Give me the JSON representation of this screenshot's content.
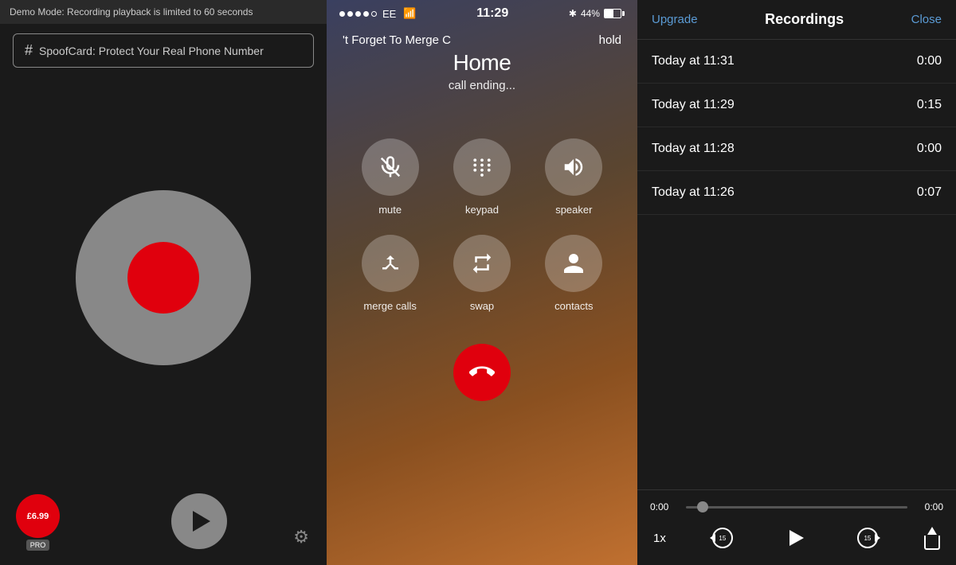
{
  "left": {
    "demo_banner": "Demo Mode: Recording playback is limited to 60 seconds",
    "spoofcard_label": "SpoofCard: Protect Your Real Phone Number",
    "hash_symbol": "#",
    "price": "£6.99",
    "pro_label": "PRO",
    "settings_symbol": "⚙"
  },
  "phone": {
    "carrier": "EE",
    "signal_dots": [
      "filled",
      "filled",
      "filled",
      "filled",
      "empty"
    ],
    "time": "11:29",
    "bluetooth": "Bluetooth",
    "battery_percent": "44%",
    "call_top_left": "'t Forget To Merge C",
    "call_top_right": "hold",
    "call_name": "Home",
    "call_status": "call ending...",
    "controls": [
      {
        "id": "mute",
        "label": "mute"
      },
      {
        "id": "keypad",
        "label": "keypad"
      },
      {
        "id": "speaker",
        "label": "speaker"
      },
      {
        "id": "merge-calls",
        "label": "merge calls"
      },
      {
        "id": "swap",
        "label": "swap"
      },
      {
        "id": "contacts",
        "label": "contacts"
      }
    ]
  },
  "recordings": {
    "title": "Recordings",
    "upgrade_label": "Upgrade",
    "close_label": "Close",
    "items": [
      {
        "time": "Today at 11:31",
        "duration": "0:00"
      },
      {
        "time": "Today at 11:29",
        "duration": "0:15"
      },
      {
        "time": "Today at 11:28",
        "duration": "0:00"
      },
      {
        "time": "Today at 11:26",
        "duration": "0:07"
      }
    ],
    "playback": {
      "current_time": "0:00",
      "end_time": "0:00",
      "speed": "1x",
      "skip_back": "15",
      "skip_forward": "15"
    }
  }
}
